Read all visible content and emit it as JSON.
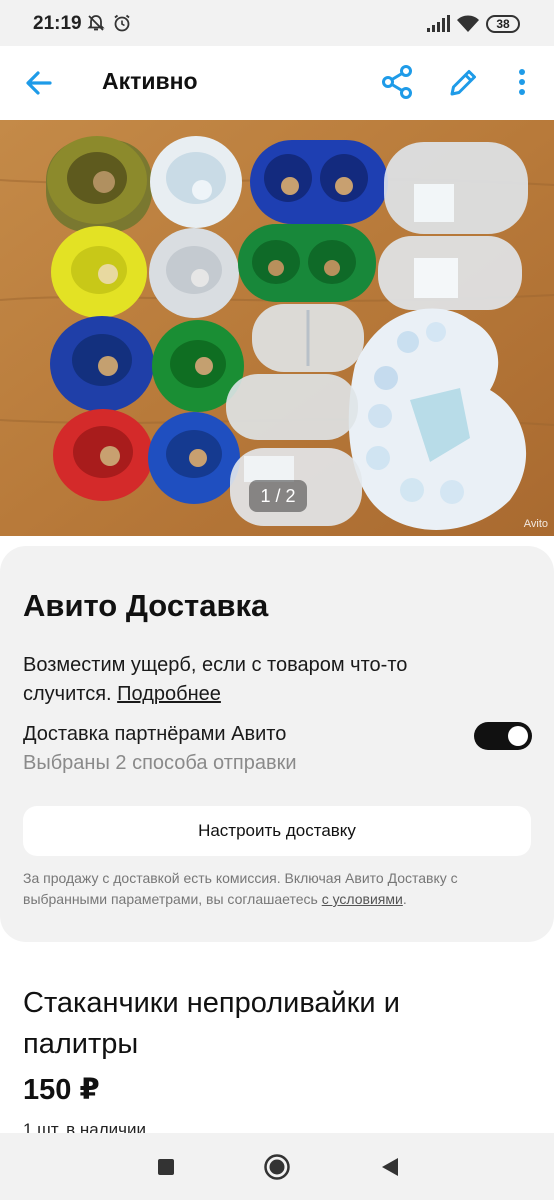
{
  "status_bar": {
    "time": "21:19",
    "battery": "38",
    "icons": [
      "bell-off-icon",
      "alarm-icon",
      "signal-icon",
      "wifi-icon",
      "battery-icon"
    ]
  },
  "app_bar": {
    "title": "Активно",
    "icons": [
      "back-arrow-icon",
      "share-icon",
      "edit-pencil-icon",
      "more-vertical-icon"
    ],
    "accent_color": "#1e9be8"
  },
  "photo": {
    "counter": "1 / 2",
    "watermark": "Avito"
  },
  "delivery": {
    "title": "Авито Доставка",
    "description": "Возместим ущерб, если с товаром что-то случится.",
    "more_link": "Подробнее",
    "partners_label": "Доставка партнёрами Авито",
    "partners_sub": "Выбраны 2 способа отправки",
    "toggle_on": true,
    "setup_button": "Настроить доставку",
    "note": "За продажу с доставкой есть комиссия. Включая Авито Доставку с выбранными параметрами, вы соглашаетесь",
    "terms_link": "с условиями",
    "note_end": "."
  },
  "listing": {
    "title": "Стаканчики непроливайки и палитры",
    "price": "150 ₽",
    "stock": "1 шт. в наличии"
  },
  "nav_bar": {
    "icons": [
      "recents-square-icon",
      "home-circle-icon",
      "back-triangle-icon"
    ]
  }
}
